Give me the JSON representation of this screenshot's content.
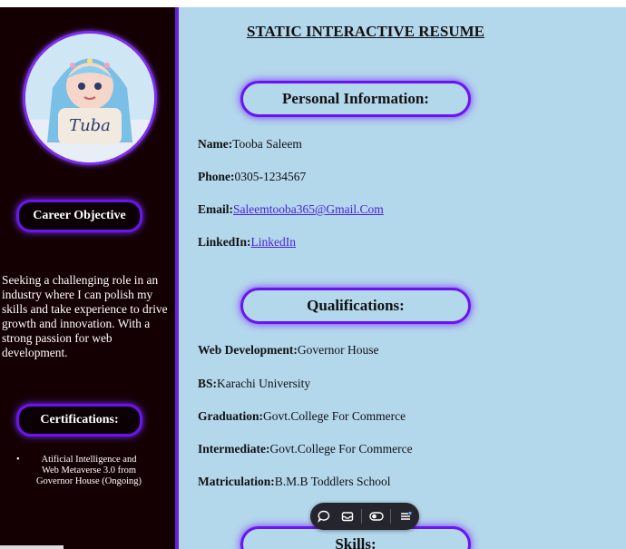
{
  "sidebar": {
    "avatar_text": "Tuba",
    "career_heading": "Career Objective",
    "objective": "Seeking a challenging role in an industry where I can polish my skills and take experience to drive growth and innovation. With a strong passion for web development.",
    "certifications_heading": "Certifications:",
    "certifications": [
      "Atificial Intelligence and Web Metaverse 3.0 from Governor House (Ongoing)"
    ]
  },
  "main": {
    "title": "STATIC INTERACTIVE RESUME",
    "personal_heading": "Personal Information:",
    "personal": {
      "name_label": "Name:",
      "name_value": "Tooba Saleem",
      "phone_label": "Phone:",
      "phone_value": "0305-1234567",
      "email_label": "Email:",
      "email_value": "Saleemtooba365@Gmail.Com",
      "linkedin_label": "LinkedIn:",
      "linkedin_value": "LinkedIn"
    },
    "qualifications_heading": "Qualifications:",
    "qualifications": [
      {
        "label": "Web Development:",
        "value": "Governor House"
      },
      {
        "label": "BS:",
        "value": "Karachi University"
      },
      {
        "label": "Graduation:",
        "value": "Govt.College For Commerce"
      },
      {
        "label": "Intermediate:",
        "value": "Govt.College For Commerce"
      },
      {
        "label": "Matriculation:",
        "value": "B.M.B Toddlers School"
      }
    ],
    "skills_heading": "Skills:"
  },
  "toolbar": {
    "icons": [
      "comment-icon",
      "inbox-icon",
      "toggle-icon",
      "menu-icon"
    ]
  },
  "colors": {
    "sidebar_bg": "#140003",
    "main_bg": "#b3d7eb",
    "accent": "#6b14f0",
    "link": "#4a22d8"
  }
}
